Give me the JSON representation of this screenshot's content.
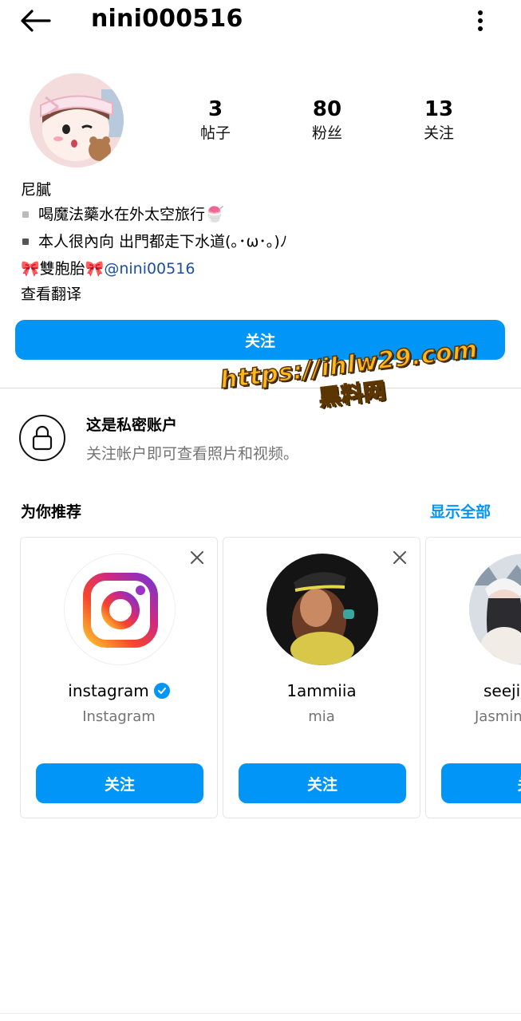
{
  "header": {
    "username": "nini000516"
  },
  "stats": [
    {
      "value": "3",
      "label": "帖子"
    },
    {
      "value": "80",
      "label": "粉丝"
    },
    {
      "value": "13",
      "label": "关注"
    }
  ],
  "bio": {
    "name": "尼膩",
    "line1": "喝魔法藥水在外太空旅行🍧",
    "line2": "本人很內向 出門都走下水道(｡･ω･｡)ﾉ",
    "line3_prefix": "🎀雙胞胎🎀 ",
    "mention": "@nini00516",
    "translate": "查看翻译"
  },
  "follow_button": "关注",
  "private": {
    "title": "这是私密账户",
    "subtitle": "关注帐户即可查看照片和视频。"
  },
  "watermark": {
    "url": "https://ihlw29.com",
    "name": "黑料网"
  },
  "suggestions": {
    "title": "为你推荐",
    "show_all": "显示全部",
    "cards": [
      {
        "username": "instagram",
        "fullname": "Instagram",
        "verified": true,
        "button": "关注"
      },
      {
        "username": "1ammiia",
        "fullname": "mia",
        "verified": false,
        "button": "关注"
      },
      {
        "username": "seeji",
        "fullname": "Jasmin",
        "verified": false,
        "button": "关"
      }
    ]
  },
  "colors": {
    "accent": "#0095f6",
    "watermark": "#ffb81c"
  }
}
